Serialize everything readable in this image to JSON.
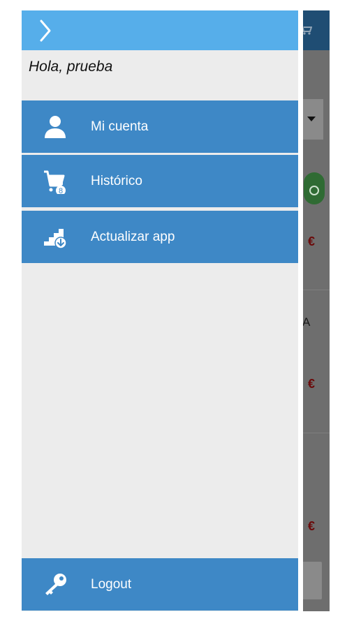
{
  "drawer": {
    "greeting": "Hola, prueba",
    "menu": [
      {
        "label": "Mi cuenta",
        "icon": "user-icon"
      },
      {
        "label": "Histórico",
        "icon": "cart-history-icon"
      },
      {
        "label": "Actualizar app",
        "icon": "update-app-icon"
      }
    ],
    "logout": {
      "label": "Logout",
      "icon": "key-icon"
    },
    "history_badge": "8"
  },
  "background": {
    "partial_letter": "A",
    "euro_symbols": [
      "€",
      "€",
      "€"
    ]
  },
  "colors": {
    "drawer_header": "#56aeea",
    "menu_item": "#3e88c6",
    "drawer_bg": "#ececec"
  }
}
